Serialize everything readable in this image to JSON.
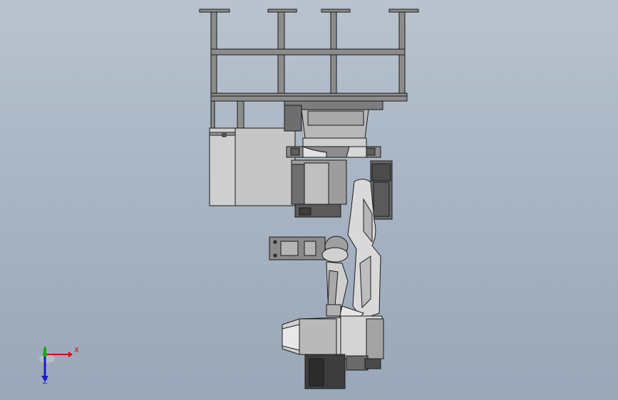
{
  "view": {
    "background_top": "#b9c3cf",
    "background_bottom": "#9aa7b8"
  },
  "model": {
    "frame_color": "#8c8c8c",
    "edge_color": "#1a1a1a",
    "body_color": "#c9c9c9",
    "dark_color": "#3d3d3d"
  },
  "triad": {
    "x_label": "X",
    "z_label": "Z",
    "x_color": "#d40000",
    "y_color": "#00b000",
    "z_color": "#1a1acc"
  }
}
